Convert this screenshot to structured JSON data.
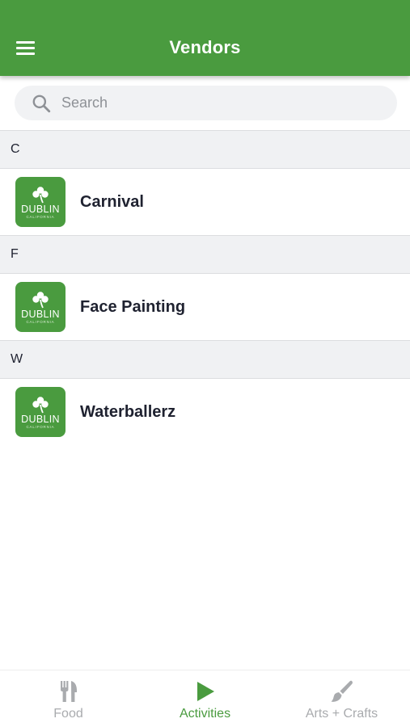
{
  "header": {
    "title": "Vendors",
    "menu_icon": "hamburger-menu-icon",
    "background_color": "#4a9b3f"
  },
  "search": {
    "placeholder": "Search",
    "value": "",
    "icon": "search-icon"
  },
  "sections": [
    {
      "letter": "C",
      "vendors": [
        {
          "name": "Carnival",
          "logo_text": "DUBLIN",
          "logo_subtext": "CALIFORNIA",
          "logo_icon": "shamrock-icon"
        }
      ]
    },
    {
      "letter": "F",
      "vendors": [
        {
          "name": "Face Painting",
          "logo_text": "DUBLIN",
          "logo_subtext": "CALIFORNIA",
          "logo_icon": "shamrock-icon"
        }
      ]
    },
    {
      "letter": "W",
      "vendors": [
        {
          "name": "Waterballerz",
          "logo_text": "DUBLIN",
          "logo_subtext": "CALIFORNIA",
          "logo_icon": "shamrock-icon"
        }
      ]
    }
  ],
  "tab_bar": {
    "tabs": [
      {
        "label": "Food",
        "icon": "fork-knife-icon",
        "active": false
      },
      {
        "label": "Activities",
        "icon": "play-icon",
        "active": true
      },
      {
        "label": "Arts + Crafts",
        "icon": "paintbrush-icon",
        "active": false
      }
    ],
    "active_color": "#4a9b3f",
    "inactive_color": "#a9abae"
  }
}
